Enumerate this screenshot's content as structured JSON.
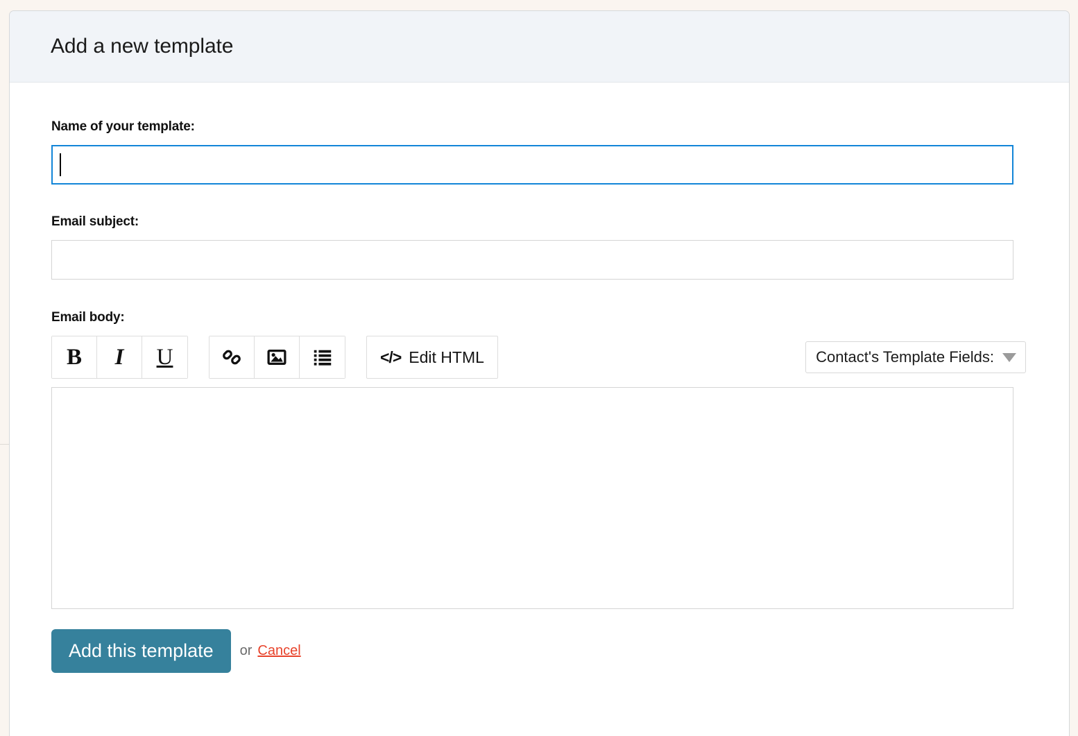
{
  "panel": {
    "title": "Add a new template"
  },
  "form": {
    "name_field": {
      "label": "Name of your template:",
      "value": "",
      "placeholder": "",
      "focused": true
    },
    "subject_field": {
      "label": "Email subject:",
      "value": "",
      "placeholder": ""
    },
    "body_field": {
      "label": "Email body:",
      "value": "",
      "placeholder": ""
    }
  },
  "toolbar": {
    "bold_label": "B",
    "italic_label": "I",
    "underline_label": "U",
    "link_icon": "link-icon",
    "image_icon": "image-icon",
    "list_icon": "bulleted-list-icon",
    "edit_html_code": "</>",
    "edit_html_label": "Edit HTML",
    "template_fields_label": "Contact's Template Fields:",
    "dropdown_caret_icon": "chevron-down-icon"
  },
  "actions": {
    "submit_label": "Add this template",
    "or_label": "or",
    "cancel_label": "Cancel"
  },
  "colors": {
    "page_background": "#faf5f0",
    "panel_header_background": "#f1f4f8",
    "panel_border": "#d5d8da",
    "input_border": "#d4d4d4",
    "focus_border": "#1285d8",
    "submit_button": "#36819c",
    "cancel_link": "#e8432b"
  }
}
